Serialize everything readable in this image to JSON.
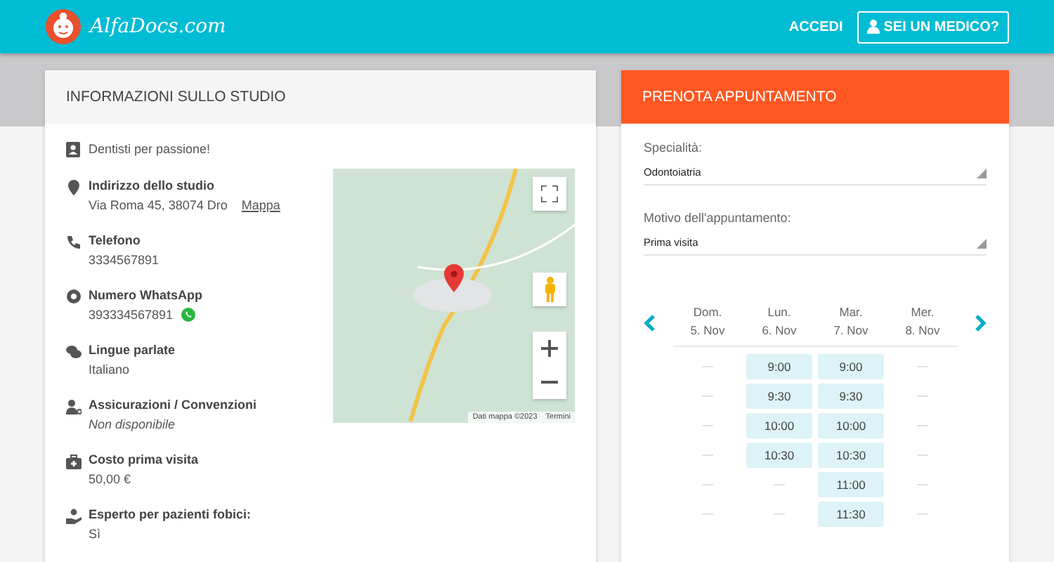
{
  "header": {
    "logo_text": "AlfaDocs.com",
    "login": "ACCEDI",
    "doctor_button": "SEI UN MEDICO?"
  },
  "info": {
    "title": "INFORMAZIONI SULLO STUDIO",
    "tagline": "Dentisti per passione!",
    "items": [
      {
        "label": "Indirizzo dello studio",
        "value": "Via Roma 45, 38074 Dro",
        "link": "Mappa",
        "whatsapp": false,
        "unavailable": false
      },
      {
        "label": "Telefono",
        "value": "3334567891",
        "whatsapp": false,
        "unavailable": false
      },
      {
        "label": "Numero WhatsApp",
        "value": "393334567891",
        "whatsapp": true,
        "unavailable": false
      },
      {
        "label": "Lingue parlate",
        "value": "Italiano",
        "whatsapp": false,
        "unavailable": false
      },
      {
        "label": "Assicurazioni / Convenzioni",
        "value": "Non disponibile",
        "whatsapp": false,
        "unavailable": true
      },
      {
        "label": "Costo prima visita",
        "value": "50,00 €",
        "whatsapp": false,
        "unavailable": false
      },
      {
        "label": "Esperto per pazienti fobici:",
        "value": "Sì",
        "whatsapp": false,
        "unavailable": false
      }
    ],
    "map": {
      "attribution": "Dati mappa ©2023",
      "terms": "Termini"
    }
  },
  "booking": {
    "title": "PRENOTA APPUNTAMENTO",
    "fields": [
      {
        "label": "Specialità:",
        "value": "Odontoiatria"
      },
      {
        "label": "Motivo dell'appuntamento:",
        "value": "Prima visita"
      }
    ],
    "days": [
      {
        "name": "Dom.",
        "date": "5. Nov",
        "slots": [
          {
            "text": "—",
            "available": false
          },
          {
            "text": "—",
            "available": false
          },
          {
            "text": "—",
            "available": false
          },
          {
            "text": "—",
            "available": false
          },
          {
            "text": "—",
            "available": false
          },
          {
            "text": "—",
            "available": false
          }
        ]
      },
      {
        "name": "Lun.",
        "date": "6. Nov",
        "slots": [
          {
            "text": "9:00",
            "available": true
          },
          {
            "text": "9:30",
            "available": true
          },
          {
            "text": "10:00",
            "available": true
          },
          {
            "text": "10:30",
            "available": true
          },
          {
            "text": "—",
            "available": false
          },
          {
            "text": "—",
            "available": false
          }
        ]
      },
      {
        "name": "Mar.",
        "date": "7. Nov",
        "slots": [
          {
            "text": "9:00",
            "available": true
          },
          {
            "text": "9:30",
            "available": true
          },
          {
            "text": "10:00",
            "available": true
          },
          {
            "text": "10:30",
            "available": true
          },
          {
            "text": "11:00",
            "available": true
          },
          {
            "text": "11:30",
            "available": true
          }
        ]
      },
      {
        "name": "Mer.",
        "date": "8. Nov",
        "slots": [
          {
            "text": "—",
            "available": false
          },
          {
            "text": "—",
            "available": false
          },
          {
            "text": "—",
            "available": false
          },
          {
            "text": "—",
            "available": false
          },
          {
            "text": "—",
            "available": false
          },
          {
            "text": "—",
            "available": false
          }
        ]
      }
    ]
  }
}
